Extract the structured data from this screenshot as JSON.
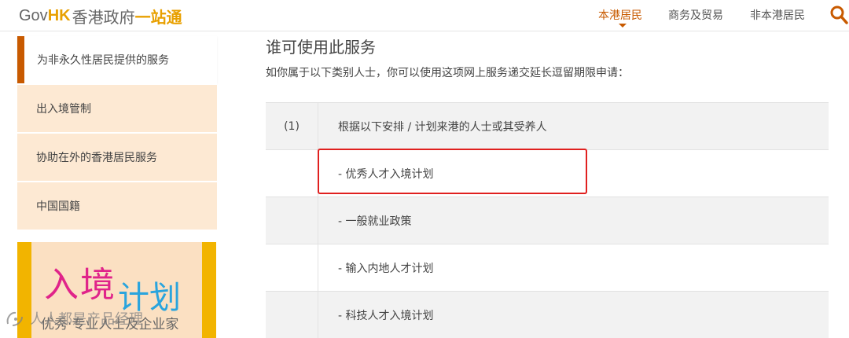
{
  "header": {
    "logo": {
      "gov": "Gov",
      "hk": "HK",
      "cn": "香港政府",
      "one_stop": "一站通"
    },
    "nav": [
      {
        "label": "本港居民",
        "active": true
      },
      {
        "label": "商务及贸易",
        "active": false
      },
      {
        "label": "非本港居民",
        "active": false
      }
    ],
    "search_icon": "search-icon",
    "accent_color": "#c85a00"
  },
  "sidebar": {
    "items": [
      {
        "label": "为非永久性居民提供的服务",
        "active": true
      },
      {
        "label": "出入境管制",
        "active": false
      },
      {
        "label": "协助在外的香港居民服务",
        "active": false
      },
      {
        "label": "中国国籍",
        "active": false
      }
    ],
    "banner": {
      "line1": "入境",
      "line2": "计划",
      "line3": "优秀·专业人士及企业家"
    }
  },
  "watermark": {
    "text": "人人都是产品经理"
  },
  "main": {
    "title": "谁可使用此服务",
    "description": "如你属于以下类别人士，你可以使用这项网上服务递交延长逗留期限申请：",
    "rows": [
      {
        "num": "(1)",
        "text": "根据以下安排 / 计划来港的人士或其受养人"
      },
      {
        "num": "",
        "text": "- 优秀人才入境计划"
      },
      {
        "num": "",
        "text": "- 一般就业政策"
      },
      {
        "num": "",
        "text": "- 输入内地人才计划"
      },
      {
        "num": "",
        "text": "- 科技人才入境计划"
      }
    ]
  }
}
